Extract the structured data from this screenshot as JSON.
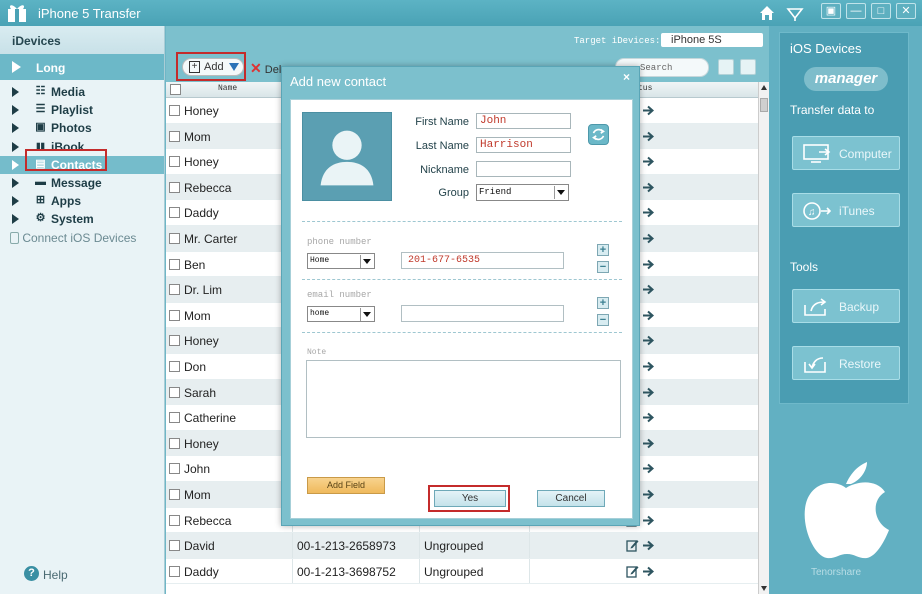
{
  "app": {
    "title": "iPhone 5 Transfer",
    "window_buttons": [
      "▣",
      "—",
      "□",
      "✕"
    ]
  },
  "sidebar": {
    "header": "iDevices",
    "device": "Long",
    "items": [
      {
        "label": "Media",
        "icon": "media-icon",
        "glyph": "☷"
      },
      {
        "label": "Playlist",
        "icon": "playlist-icon",
        "glyph": "☰"
      },
      {
        "label": "Photos",
        "icon": "photos-icon",
        "glyph": "▣"
      },
      {
        "label": "iBook",
        "icon": "book-icon",
        "glyph": "▮▮"
      },
      {
        "label": "Contacts",
        "icon": "contacts-icon",
        "glyph": "▤"
      },
      {
        "label": "Message",
        "icon": "message-icon",
        "glyph": "▬"
      },
      {
        "label": "Apps",
        "icon": "apps-icon",
        "glyph": "⊞"
      },
      {
        "label": "System",
        "icon": "system-icon",
        "glyph": "⚙"
      }
    ],
    "connect": "Connect iOS Devices",
    "help": "Help"
  },
  "main": {
    "target_label": "Target iDevices:",
    "target_device": "iPhone 5S",
    "toolbar": {
      "add": "Add",
      "delete": "Dele",
      "search_placeholder": "Search"
    },
    "columns": {
      "name": "Name",
      "status": "tus"
    },
    "rows": [
      {
        "name": "Honey",
        "phone": "",
        "group": ""
      },
      {
        "name": "Mom",
        "phone": "",
        "group": ""
      },
      {
        "name": "Honey",
        "phone": "",
        "group": ""
      },
      {
        "name": "Rebecca",
        "phone": "",
        "group": ""
      },
      {
        "name": "Daddy",
        "phone": "",
        "group": ""
      },
      {
        "name": "Mr. Carter",
        "phone": "",
        "group": ""
      },
      {
        "name": "Ben",
        "phone": "",
        "group": ""
      },
      {
        "name": "Dr. Lim",
        "phone": "",
        "group": ""
      },
      {
        "name": "Mom",
        "phone": "",
        "group": ""
      },
      {
        "name": "Honey",
        "phone": "",
        "group": ""
      },
      {
        "name": "Don",
        "phone": "",
        "group": ""
      },
      {
        "name": "Sarah",
        "phone": "",
        "group": ""
      },
      {
        "name": "Catherine",
        "phone": "",
        "group": ""
      },
      {
        "name": "Honey",
        "phone": "",
        "group": ""
      },
      {
        "name": "John",
        "phone": "",
        "group": ""
      },
      {
        "name": "Mom",
        "phone": "",
        "group": ""
      },
      {
        "name": "Rebecca",
        "phone": "",
        "group": ""
      },
      {
        "name": "David",
        "phone": "00-1-213-2658973",
        "group": "Ungrouped"
      },
      {
        "name": "Daddy",
        "phone": "00-1-213-3698752",
        "group": "Ungrouped"
      }
    ]
  },
  "right": {
    "title": "iOS Devices",
    "badge": "manager",
    "transfer_label": "Transfer data to",
    "computer": "Computer",
    "itunes": "iTunes",
    "tools": "Tools",
    "backup": "Backup",
    "restore": "Restore",
    "brand": "Tenorshare"
  },
  "dialog": {
    "title": "Add new contact",
    "close": "×",
    "first_name_label": "First Name",
    "first_name": "John",
    "last_name_label": "Last Name",
    "last_name": "Harrison",
    "nickname_label": "Nickname",
    "nickname": "",
    "group_label": "Group",
    "group": "Friend",
    "phone_section": "phone number",
    "phone_type": "Home",
    "phone_value": "201-677-6535",
    "email_section": "email number",
    "email_type": "home",
    "email_value": "",
    "note_label": "Note",
    "add_field": "Add Field",
    "yes": "Yes",
    "cancel": "Cancel"
  },
  "colors": {
    "accent": "#7cc0cd",
    "highlight": "#c42b2b",
    "input_text": "#c0392b"
  }
}
